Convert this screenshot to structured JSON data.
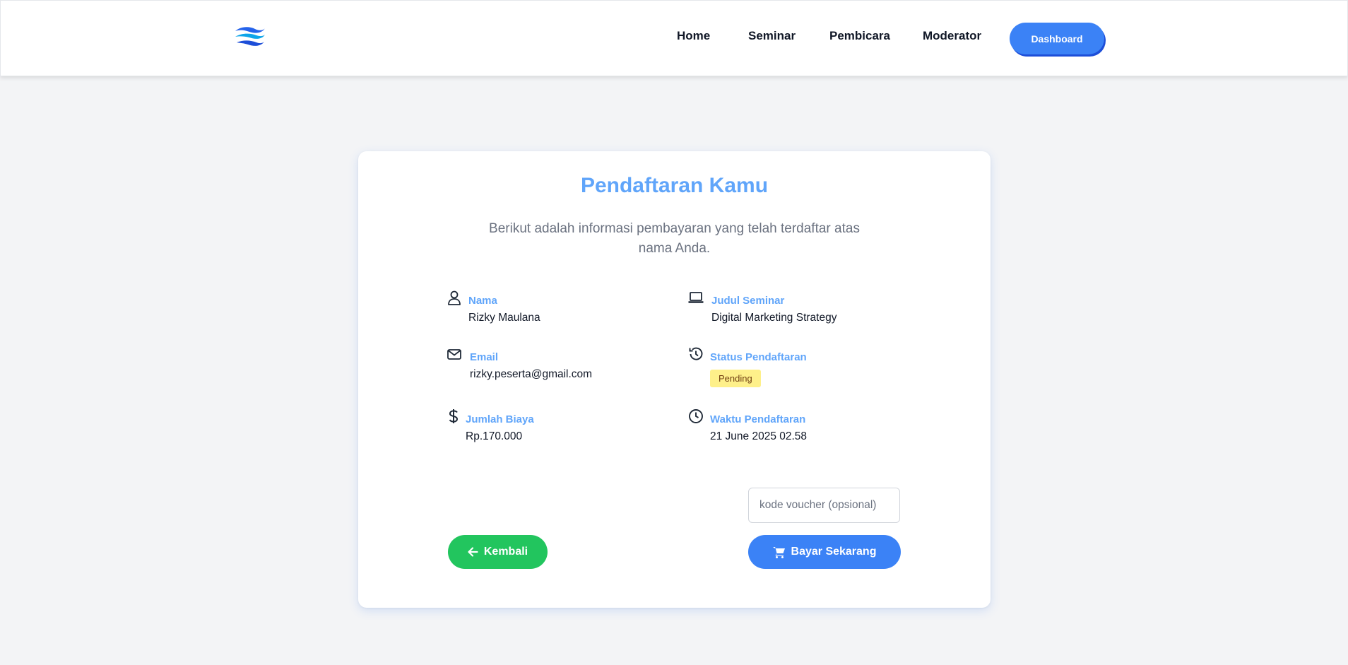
{
  "header": {
    "logo": "wave-logo",
    "nav": {
      "home": "Home",
      "seminar": "Seminar",
      "pembicara": "Pembicara",
      "moderator": "Moderator"
    },
    "dashboard_label": "Dashboard"
  },
  "card": {
    "title": "Pendaftaran Kamu",
    "subtitle": "Berikut adalah informasi pembayaran yang telah terdaftar atas nama Anda.",
    "fields": {
      "nama": {
        "label": "Nama",
        "value": "Rizky Maulana",
        "icon": "user-icon"
      },
      "email": {
        "label": "Email",
        "value": "rizky.peserta@gmail.com",
        "icon": "envelope-icon"
      },
      "biaya": {
        "label": "Jumlah Biaya",
        "value": "Rp.170.000",
        "icon": "dollar-icon"
      },
      "judul": {
        "label": "Judul Seminar",
        "value": "Digital Marketing Strategy",
        "icon": "laptop-icon"
      },
      "status": {
        "label": "Status Pendaftaran",
        "value": "Pending",
        "icon": "history-icon"
      },
      "waktu": {
        "label": "Waktu Pendaftaran",
        "value": "21 June 2025 02.58",
        "icon": "clock-icon"
      }
    },
    "voucher": {
      "placeholder": "kode voucher (opsional)",
      "value": ""
    },
    "back_label": "Kembali",
    "pay_label": "Bayar Sekarang"
  },
  "colors": {
    "primary": "#3b82f6",
    "label": "#60a5fa",
    "success": "#22c55e",
    "badge_pending": "#fef08a",
    "background": "#f3f4f6"
  }
}
